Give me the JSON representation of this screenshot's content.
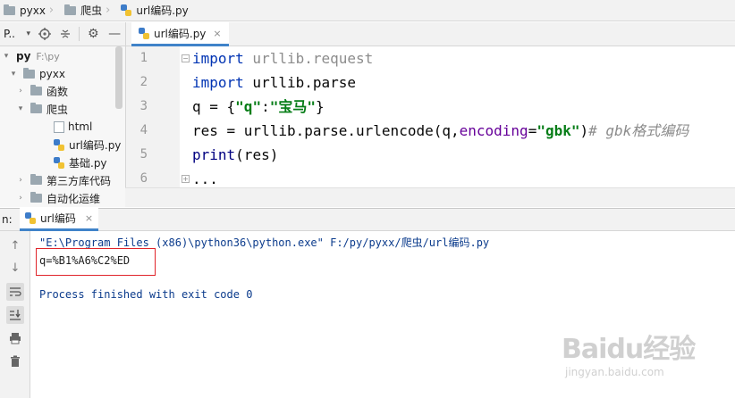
{
  "breadcrumb": {
    "items": [
      "pyxx",
      "爬虫",
      "url编码.py"
    ]
  },
  "project_toolbar": {
    "label": "P.."
  },
  "editor_tab": {
    "label": "url编码.py",
    "close": "×"
  },
  "tree": {
    "root_label": "py",
    "root_path": "F:\\py",
    "items": [
      {
        "label": "pyxx"
      },
      {
        "label": "函数"
      },
      {
        "label": "爬虫"
      },
      {
        "label": "html"
      },
      {
        "label": "url编码.py"
      },
      {
        "label": "基础.py"
      },
      {
        "label": "第三方库代码"
      },
      {
        "label": "自动化运维"
      }
    ]
  },
  "editor": {
    "line_numbers": [
      "1",
      "2",
      "3",
      "4",
      "5",
      "6"
    ],
    "lines": {
      "l1": {
        "kw": "import",
        "module": " urllib.request"
      },
      "l2": {
        "kw": "import",
        "rest": " urllib.parse"
      },
      "l3": {
        "a": "q = {",
        "s1": "\"q\"",
        "b": ":",
        "s2": "\"宝马\"",
        "c": "}"
      },
      "l4": {
        "a": "res = urllib.parse.urlencode(q,",
        "param": "encoding",
        "b": "=",
        "s": "\"gbk\"",
        "c": ")",
        "comment": "# gbk格式编码"
      },
      "l5": {
        "fn": "print",
        "rest": "(res)"
      },
      "l6": {
        "text": "..."
      }
    }
  },
  "run_panel": {
    "label": "n:",
    "tab_label": "url编码",
    "close": "×",
    "console": {
      "command": "\"E:\\Program Files (x86)\\python36\\python.exe\" F:/py/pyxx/爬虫/url编码.py",
      "output": "q=%B1%A6%C2%ED",
      "exit": "Process finished with exit code 0"
    }
  },
  "watermark": {
    "brand": "Baidu经验",
    "url": "jingyan.baidu.com"
  },
  "colors": {
    "keyword": "#0033b3",
    "string": "#067d17",
    "comment": "#8c8c8c",
    "highlight_box": "#e0242a",
    "tab_accent": "#4083c9"
  }
}
